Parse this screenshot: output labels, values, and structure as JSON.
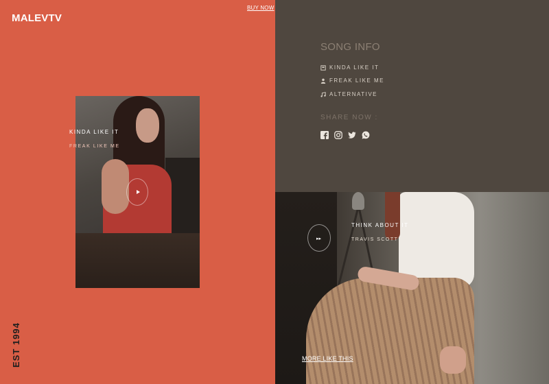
{
  "brand": "MALEVTV",
  "buy_now": "BUY NOW",
  "est": "EST 1994",
  "featured": {
    "title": "KINDA LIKE IT",
    "subtitle": "FREAK LIKE ME"
  },
  "song_info": {
    "heading": "SONG INFO",
    "items": [
      {
        "icon": "disc-icon",
        "label": "KINDA LIKE IT"
      },
      {
        "icon": "user-icon",
        "label": "FREAK LIKE ME"
      },
      {
        "icon": "music-note-icon",
        "label": "ALTERNATIVE"
      }
    ],
    "share_label": "SHARE NOW :",
    "socials": [
      "facebook-icon",
      "instagram-icon",
      "twitter-icon",
      "whatsapp-icon"
    ]
  },
  "second": {
    "title": "THINK ABOUT IT",
    "artist": "TRAVIS SCOTT",
    "more": "MORE LIKE THIS"
  },
  "colors": {
    "left_panel": "#d95e46",
    "right_panel": "#4f473f",
    "heading_muted": "#8c8074"
  }
}
